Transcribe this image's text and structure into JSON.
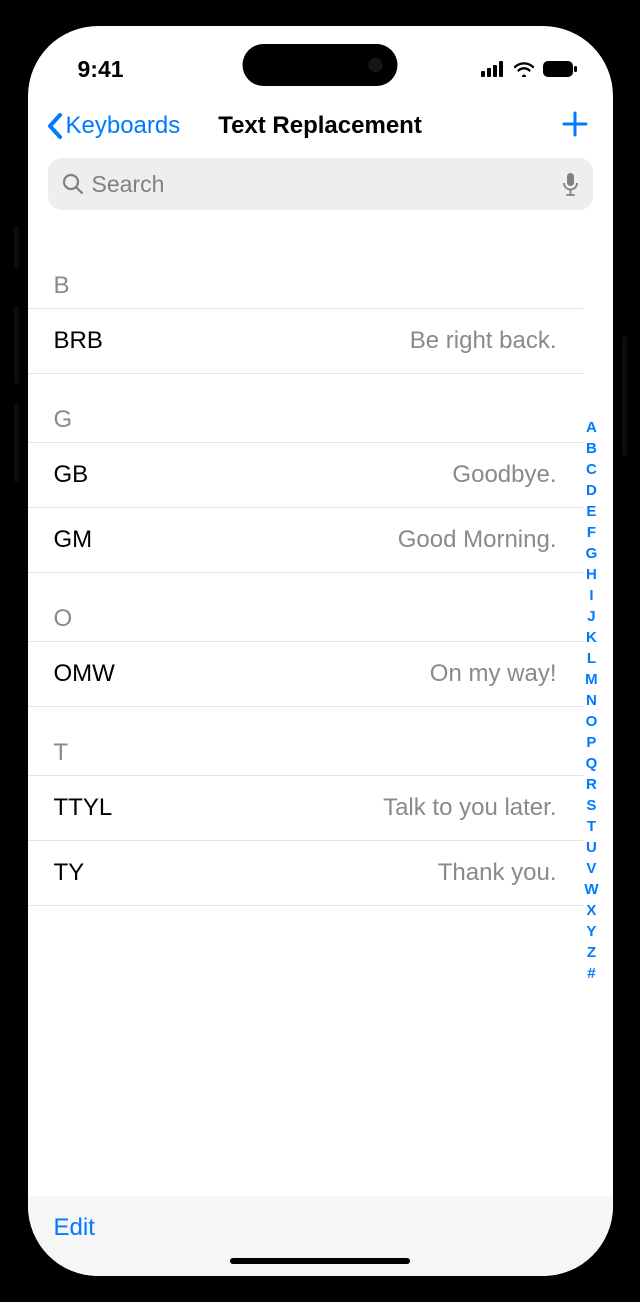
{
  "status": {
    "time": "9:41"
  },
  "nav": {
    "back_label": "Keyboards",
    "title": "Text Replacement"
  },
  "search": {
    "placeholder": "Search"
  },
  "sections": [
    {
      "letter": "B",
      "items": [
        {
          "shortcut": "BRB",
          "phrase": "Be right back."
        }
      ]
    },
    {
      "letter": "G",
      "items": [
        {
          "shortcut": "GB",
          "phrase": "Goodbye."
        },
        {
          "shortcut": "GM",
          "phrase": "Good Morning."
        }
      ]
    },
    {
      "letter": "O",
      "items": [
        {
          "shortcut": "OMW",
          "phrase": "On my way!"
        }
      ]
    },
    {
      "letter": "T",
      "items": [
        {
          "shortcut": "TTYL",
          "phrase": "Talk to you later."
        },
        {
          "shortcut": "TY",
          "phrase": "Thank you."
        }
      ]
    }
  ],
  "index_letters": [
    "A",
    "B",
    "C",
    "D",
    "E",
    "F",
    "G",
    "H",
    "I",
    "J",
    "K",
    "L",
    "M",
    "N",
    "O",
    "P",
    "Q",
    "R",
    "S",
    "T",
    "U",
    "V",
    "W",
    "X",
    "Y",
    "Z",
    "#"
  ],
  "toolbar": {
    "edit_label": "Edit"
  }
}
